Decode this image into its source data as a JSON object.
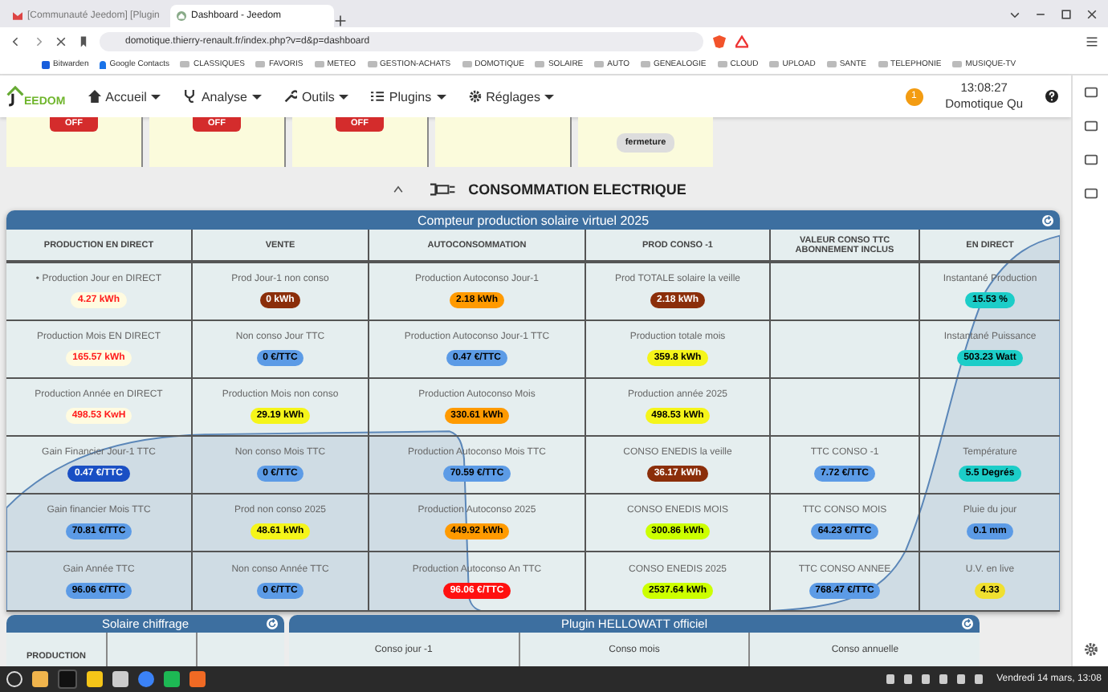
{
  "browser": {
    "tabs": [
      {
        "label": "[Communauté Jeedom] [Plugin",
        "selected": false
      },
      {
        "label": "Dashboard - Jeedom",
        "selected": true
      }
    ],
    "url": "domotique.thierry-renault.fr/index.php?v=d&p=dashboard",
    "bookmarks": [
      {
        "kind": "app",
        "label": "Bitwarden"
      },
      {
        "kind": "person",
        "label": "Google Contacts"
      },
      {
        "kind": "folder",
        "label": "CLASSIQUES"
      },
      {
        "kind": "folder",
        "label": "FAVORIS"
      },
      {
        "kind": "folder",
        "label": "METEO"
      },
      {
        "kind": "folder",
        "label": "GESTION-ACHATS"
      },
      {
        "kind": "folder",
        "label": "DOMOTIQUE"
      },
      {
        "kind": "folder",
        "label": "SOLAIRE"
      },
      {
        "kind": "folder",
        "label": "AUTO"
      },
      {
        "kind": "folder",
        "label": "GENEALOGIE"
      },
      {
        "kind": "folder",
        "label": "CLOUD"
      },
      {
        "kind": "folder",
        "label": "UPLOAD"
      },
      {
        "kind": "folder",
        "label": "SANTE"
      },
      {
        "kind": "folder",
        "label": "TELEPHONIE"
      },
      {
        "kind": "folder",
        "label": "MUSIQUE-TV"
      }
    ]
  },
  "navbar": {
    "logo": "EEDOM",
    "menus": [
      {
        "kind": "home",
        "label": "Accueil"
      },
      {
        "kind": "health",
        "label": "Analyse"
      },
      {
        "kind": "tools",
        "label": "Outils"
      },
      {
        "kind": "list",
        "label": "Plugins"
      },
      {
        "kind": "gear",
        "label": "Réglages"
      }
    ],
    "notification_count": "1",
    "time": "13:08:27",
    "user": "Domotique Qu"
  },
  "tiles": [
    {
      "kind": "switch",
      "label": "OFF",
      "on": false
    },
    {
      "kind": "switch",
      "label": "OFF",
      "on": false
    },
    {
      "kind": "switch",
      "label": "OFF",
      "on": false
    },
    {
      "kind": "blank"
    },
    {
      "kind": "button",
      "label": "fermeture"
    }
  ],
  "section": {
    "title": "CONSOMMATION ELECTRIQUE"
  },
  "table": {
    "title": "Compteur production solaire virtuel 2025",
    "columns": [
      "PRODUCTION EN DIRECT",
      "VENTE",
      "AUTOCONSOMMATION",
      "PROD CONSO -1",
      "VALEUR CONSO TTC ABONNEMENT INCLUS",
      "EN DIRECT"
    ],
    "rows": [
      [
        {
          "label": "• Production Jour en DIRECT",
          "value": "4.27 kWh",
          "color": "#fffbe0"
        },
        {
          "label": "Prod Jour-1 non conso",
          "value": "0 kWh",
          "color": "#8b2e0a"
        },
        {
          "label": "Production Autoconso Jour-1",
          "value": "2.18 kWh",
          "color": "#ff9a00"
        },
        {
          "label": "Prod TOTALE solaire la veille",
          "value": "2.18 kWh",
          "color": "#8b2e0a"
        },
        null,
        {
          "label": "Instantané Production",
          "value": "15.53 %",
          "color": "#1ccdc8"
        }
      ],
      [
        {
          "label": "Production Mois EN DIRECT",
          "value": "165.57 kWh",
          "color": "#fffbe0"
        },
        {
          "label": "Non conso Jour TTC",
          "value": "0 €/TTC",
          "color": "#5c9be6"
        },
        {
          "label": "Production Autoconso Jour-1 TTC",
          "value": "0.47 €/TTC",
          "color": "#5c9be6"
        },
        {
          "label": "Production totale mois",
          "value": "359.8 kWh",
          "color": "#f5f51a"
        },
        null,
        {
          "label": "Instantané Puissance",
          "value": "503.23 Watt",
          "color": "#1ccdc8"
        }
      ],
      [
        {
          "label": "Production Année en DIRECT",
          "value": "498.53 KwH",
          "color": "#fffbe0"
        },
        {
          "label": "Production Mois non conso",
          "value": "29.19 kWh",
          "color": "#f5f51a"
        },
        {
          "label": "Production Autoconso Mois",
          "value": "330.61 kWh",
          "color": "#ff9a00"
        },
        {
          "label": "Production année 2025",
          "value": "498.53 kWh",
          "color": "#f5f51a"
        },
        null,
        null
      ],
      [
        {
          "label": "Gain Financier Jour-1 TTC",
          "value": "0.47 €/TTC",
          "color": "#1a4fc4"
        },
        {
          "label": "Non conso Mois TTC",
          "value": "0 €/TTC",
          "color": "#5c9be6"
        },
        {
          "label": "Production Autoconso Mois TTC",
          "value": "70.59 €/TTC",
          "color": "#5c9be6"
        },
        {
          "label": "CONSO ENEDIS la veille",
          "value": "36.17 kWh",
          "color": "#8b2e0a"
        },
        {
          "label": "TTC CONSO -1",
          "value": "7.72 €/TTC",
          "color": "#5c9be6"
        },
        {
          "label": "Température",
          "value": "5.5 Degrés",
          "color": "#1ccdc8"
        }
      ],
      [
        {
          "label": "Gain financier Mois TTC",
          "value": "70.81 €/TTC",
          "color": "#5c9be6"
        },
        {
          "label": "Prod non conso 2025",
          "value": "48.61 kWh",
          "color": "#f5f51a"
        },
        {
          "label": "Production Autoconso 2025",
          "value": "449.92 kWh",
          "color": "#ff9a00"
        },
        {
          "label": "CONSO ENEDIS MOIS",
          "value": "300.86 kWh",
          "color": "#ccff00"
        },
        {
          "label": "TTC CONSO MOIS",
          "value": "64.23 €/TTC",
          "color": "#5c9be6"
        },
        {
          "label": "Pluie du jour",
          "value": "0.1 mm",
          "color": "#5c9be6"
        }
      ],
      [
        {
          "label": "Gain Année TTC",
          "value": "96.06 €/TTC",
          "color": "#5c9be6"
        },
        {
          "label": "Non conso Année TTC",
          "value": "0 €/TTC",
          "color": "#5c9be6"
        },
        {
          "label": "Production Autoconso An TTC",
          "value": "96.06 €/TTC",
          "color": "#ff1010"
        },
        {
          "label": "CONSO ENEDIS 2025",
          "value": "2537.64 kWh",
          "color": "#ccff00"
        },
        {
          "label": "TTC CONSO ANNEE",
          "value": "768.47 €/TTC",
          "color": "#5c9be6"
        },
        {
          "label": "U.V. en live",
          "value": "4.33",
          "color": "#f0e030"
        }
      ]
    ]
  },
  "panels": [
    {
      "kind": "table",
      "title": "Solaire chiffrage",
      "columns": [
        "PRODUCTION"
      ]
    },
    {
      "kind": "cards",
      "title": "Plugin HELLOWATT officiel",
      "columns": [
        "Conso jour -1",
        "Conso mois",
        "Conso annuelle"
      ]
    }
  ],
  "taskbar": {
    "clock": "Vendredi 14 mars, 13:08"
  }
}
